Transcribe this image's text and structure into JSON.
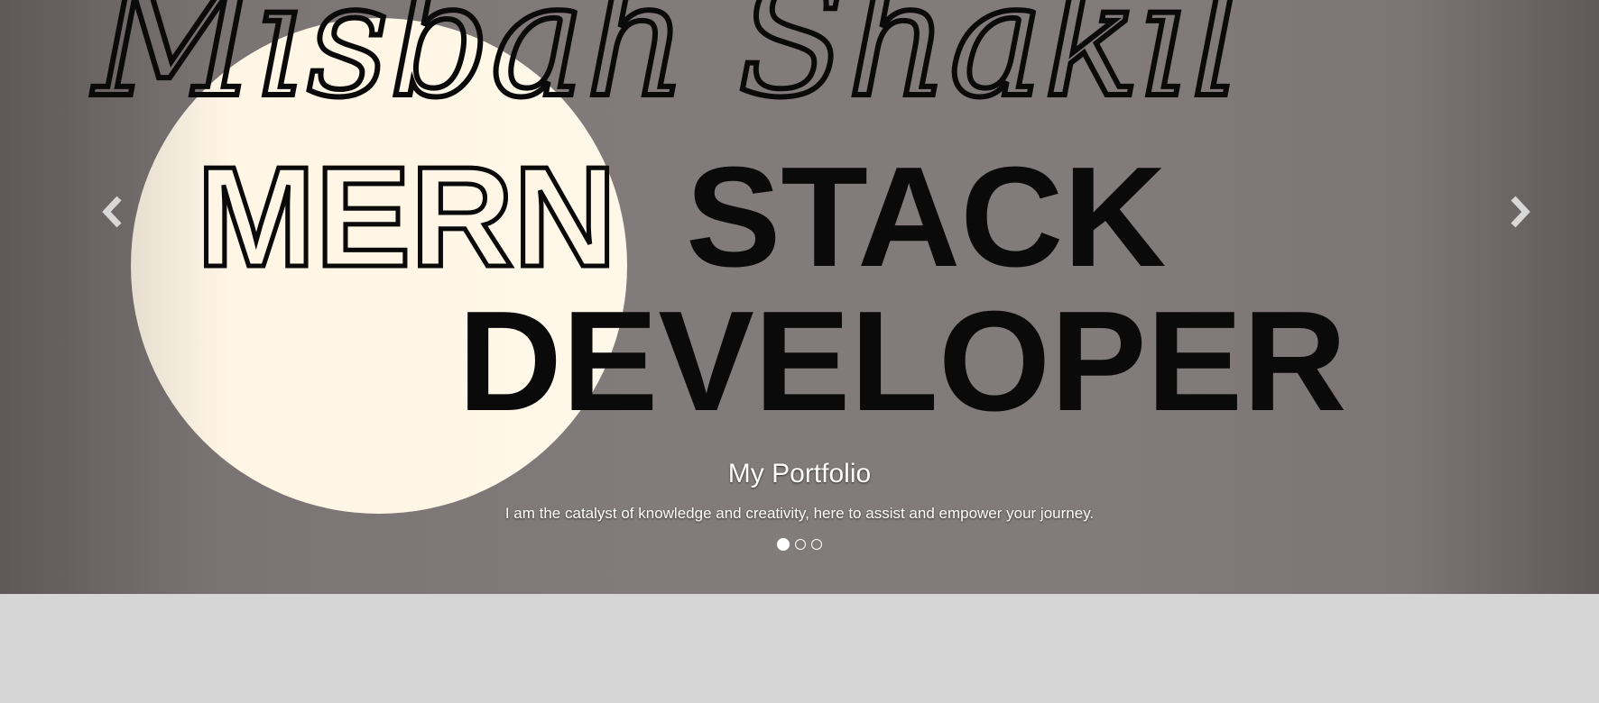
{
  "hero": {
    "name": "Misbah Shakil",
    "headline_outline": "MERN",
    "headline_line1": "STACK",
    "headline_line2": "DEVELOPER"
  },
  "caption": {
    "title": "My Portfolio",
    "text": "I am the catalyst of knowledge and creativity, here to assist and empower your journey."
  },
  "carousel": {
    "prev_icon": "chevron-left-icon",
    "next_icon": "chevron-right-icon",
    "slides": 3,
    "active_index": 0
  },
  "colors": {
    "moon": "#fff6e6",
    "text_dark": "#0a0a0a",
    "caption_text": "#ffffff",
    "page_bg": "#d6d6d6"
  }
}
